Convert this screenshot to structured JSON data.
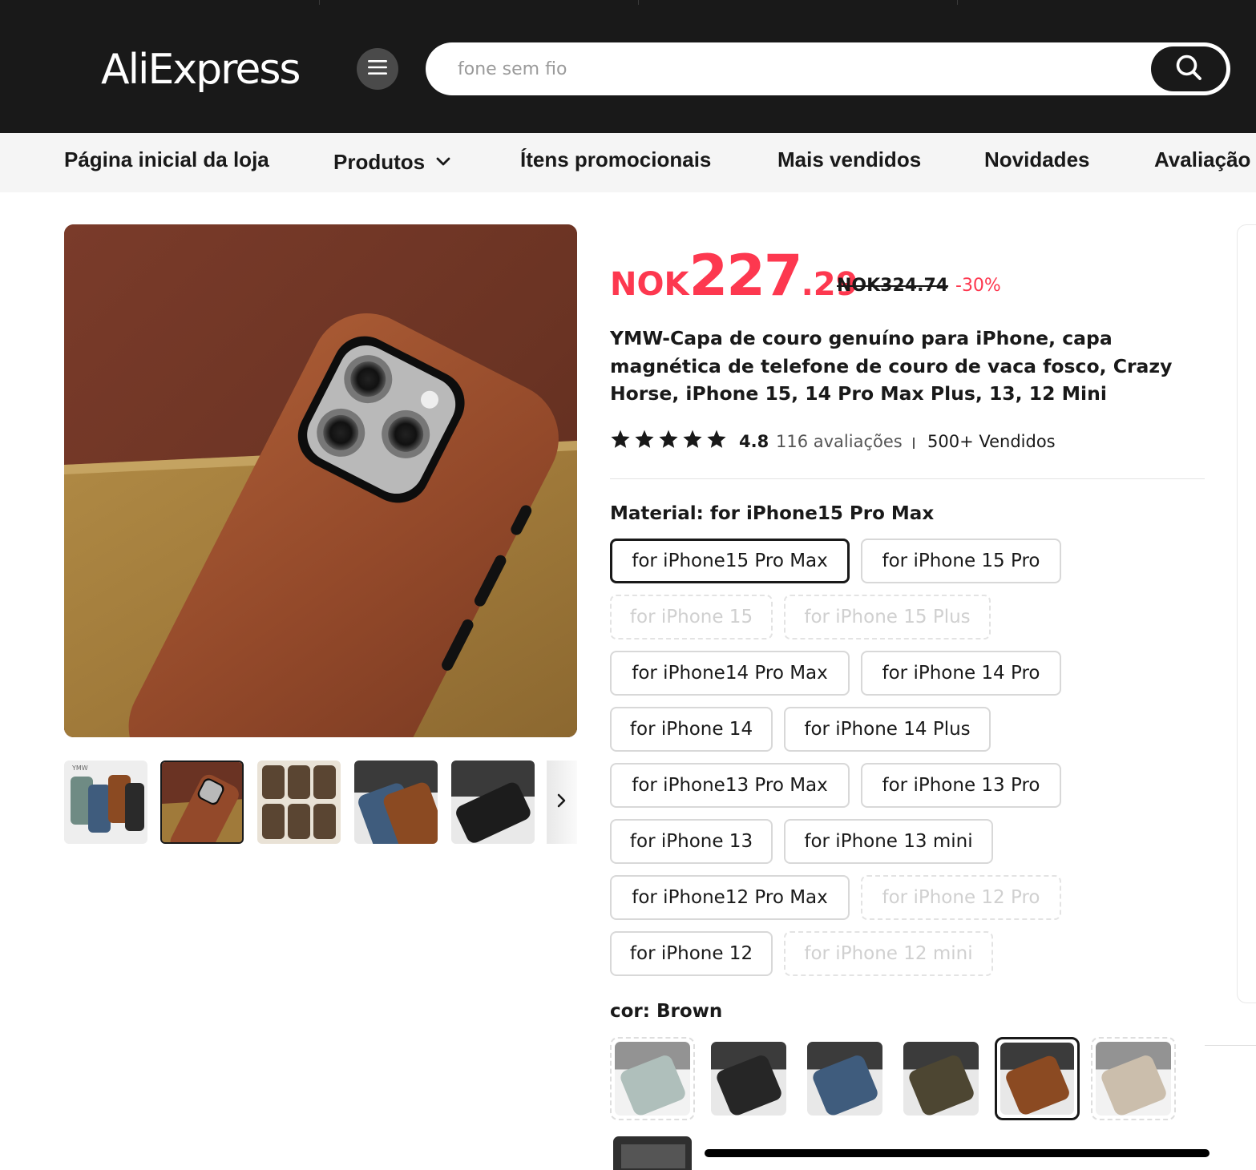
{
  "header": {
    "logo_text": "AliExpress",
    "menu_icon": "hamburger-menu-icon",
    "search": {
      "placeholder": "fone sem fio",
      "value": ""
    },
    "search_icon": "search-icon"
  },
  "store_nav": {
    "items": [
      {
        "label": "Página inicial da loja"
      },
      {
        "label": "Produtos",
        "icon": "chevron-down-icon"
      },
      {
        "label": "Ítens promocionais"
      },
      {
        "label": "Mais vendidos"
      },
      {
        "label": "Novidades"
      },
      {
        "label": "Avaliação"
      }
    ]
  },
  "gallery": {
    "thumbnail_count_visible": 6,
    "selected_index": 1,
    "next_icon": "chevron-right-icon"
  },
  "product": {
    "price": {
      "currency": "NOK",
      "integer": "227",
      "decimal": ".29"
    },
    "original_price": "NOK324.74",
    "discount": "-30%",
    "title": "YMW-Capa de couro genuíno para iPhone, capa magnética de telefone de couro de vaca fosco, Crazy Horse, iPhone 15, 14 Pro Max Plus, 13, 12 Mini",
    "rating": {
      "stars": 5,
      "value": "4.8",
      "reviews": "116 avaliações",
      "sold": "500+ Vendidos"
    }
  },
  "material": {
    "label": "Material: ",
    "selected": "for iPhone15 Pro Max",
    "options": [
      {
        "label": "for iPhone15 Pro Max",
        "state": "selected"
      },
      {
        "label": "for iPhone 15 Pro",
        "state": "available"
      },
      {
        "label": "for iPhone 15",
        "state": "disabled"
      },
      {
        "label": "for iPhone 15 Plus",
        "state": "disabled"
      },
      {
        "label": "for iPhone14 Pro Max",
        "state": "available"
      },
      {
        "label": "for iPhone 14 Pro",
        "state": "available"
      },
      {
        "label": "for iPhone 14",
        "state": "available"
      },
      {
        "label": "for iPhone 14 Plus",
        "state": "available"
      },
      {
        "label": "for iPhone13 Pro Max",
        "state": "available"
      },
      {
        "label": "for iPhone 13 Pro",
        "state": "available"
      },
      {
        "label": "for iPhone 13",
        "state": "available"
      },
      {
        "label": "for iPhone 13 mini",
        "state": "available"
      },
      {
        "label": "for iPhone12 Pro Max",
        "state": "available"
      },
      {
        "label": "for iPhone 12 Pro",
        "state": "disabled"
      },
      {
        "label": "for iPhone 12",
        "state": "available"
      },
      {
        "label": "for iPhone 12 mini",
        "state": "disabled"
      }
    ]
  },
  "color": {
    "label": "cor: ",
    "selected": "Brown",
    "swatches": [
      {
        "state": "disabled",
        "case_color": "#6f8b84"
      },
      {
        "state": "available",
        "case_color": "#262626"
      },
      {
        "state": "available",
        "case_color": "#3f5c7d"
      },
      {
        "state": "available",
        "case_color": "#4d4632"
      },
      {
        "state": "selected",
        "case_color": "#8b4a22"
      },
      {
        "state": "disabled",
        "case_color": "#a18a6a"
      }
    ]
  },
  "colors": {
    "accent": "#fd384f",
    "header_bg": "#191919",
    "nav_bg": "#f5f5f5"
  }
}
